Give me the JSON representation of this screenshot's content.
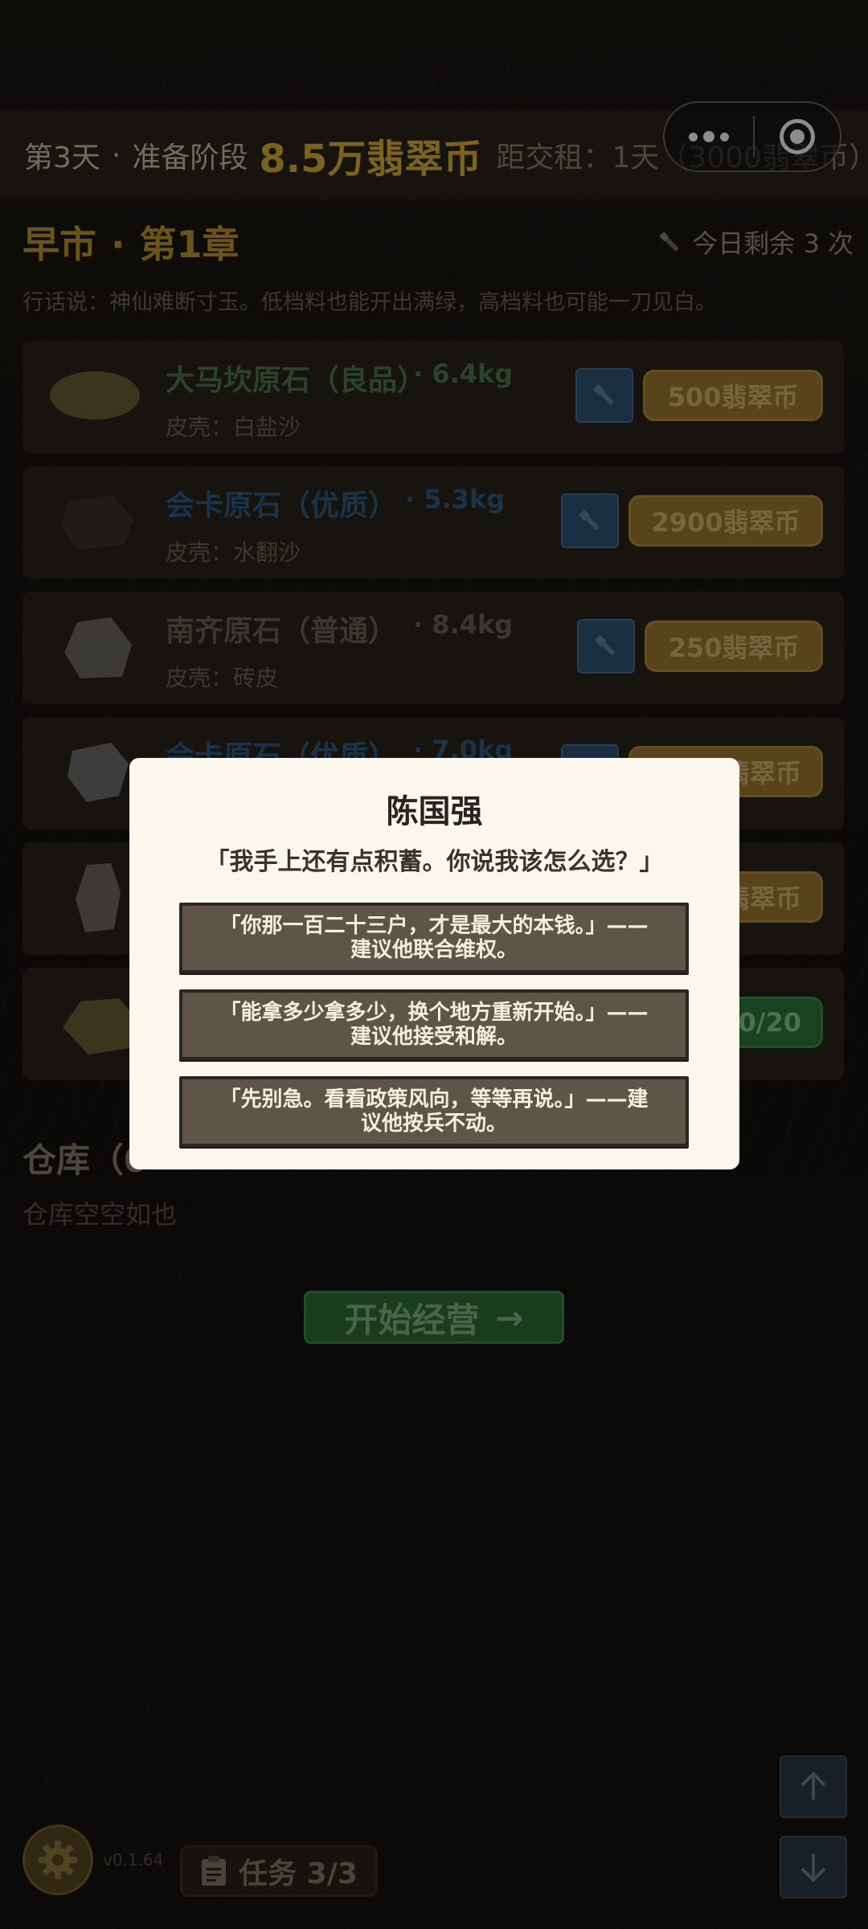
{
  "topbar": {
    "day": "第3天",
    "dot": "·",
    "phase": "准备阶段",
    "coins": "8.5万翡翠币",
    "rent_text": "距交租：1天（3000翡翠币）"
  },
  "chapter": {
    "market": "早市",
    "dot": "·",
    "chapter_label": "第1章",
    "remaining": "今日剩余 3 次",
    "proverb": "行话说：神仙难断寸玉。低档料也能开出满绿，高档料也可能一刀见白。"
  },
  "stones": [
    {
      "name": "大马坎原石（良品）",
      "weight": "· 6.4kg",
      "skin": "皮壳：白盐沙",
      "price": "500翡翠币",
      "name_color": "#4f7a4c",
      "shape_color": "#6b6234"
    },
    {
      "name": "会卡原石（优质）",
      "weight": "· 5.3kg",
      "skin": "皮壳：水翻沙",
      "price": "2900翡翠币",
      "name_color": "#2f5f84",
      "shape_color": "#3b362e"
    },
    {
      "name": "南齐原石（普通）",
      "weight": "· 8.4kg",
      "skin": "皮壳：砖皮",
      "price": "250翡翠币",
      "name_color": "#6a645a",
      "shape_color": "#6e6a64"
    },
    {
      "name": "会卡原石（优质）",
      "weight": "· 7.0kg",
      "skin": "",
      "price": "翡翠币",
      "name_color": "#2f5f84",
      "shape_color": "#707070"
    },
    {
      "name": "",
      "weight": "",
      "skin": "",
      "price": "翡翠币",
      "name_color": "#6a645a",
      "shape_color": "#6f6b66"
    },
    {
      "name": "",
      "weight": "",
      "skin": "",
      "price": "0/20",
      "name_color": "#6a645a",
      "shape_color": "#6a6133"
    }
  ],
  "warehouse": {
    "title": "仓库（0",
    "empty": "仓库空空如也"
  },
  "start_button": {
    "label": "开始经营",
    "arrow": "→"
  },
  "footer": {
    "version": "v0.1.64",
    "task_label": "任务 3/3"
  },
  "modal": {
    "name": "陈国强",
    "quote": "「我手上还有点积蓄。你说我该怎么选？」",
    "choices": [
      "「你那一百二十三户，才是最大的本钱。」——建议他联合维权。",
      "「能拿多少拿多少，换个地方重新开始。」——建议他接受和解。",
      "「先别急。看看政策风向，等等再说。」——建议他按兵不动。"
    ]
  },
  "icons": {
    "capsule_more": "more-dots-icon",
    "capsule_close": "target-close-icon",
    "remaining": "torch-icon",
    "flashlight": "flashlight-icon",
    "settings": "gear-icon",
    "task": "clipboard-icon",
    "scroll_up": "arrow-up-icon",
    "scroll_down": "arrow-down-icon"
  }
}
